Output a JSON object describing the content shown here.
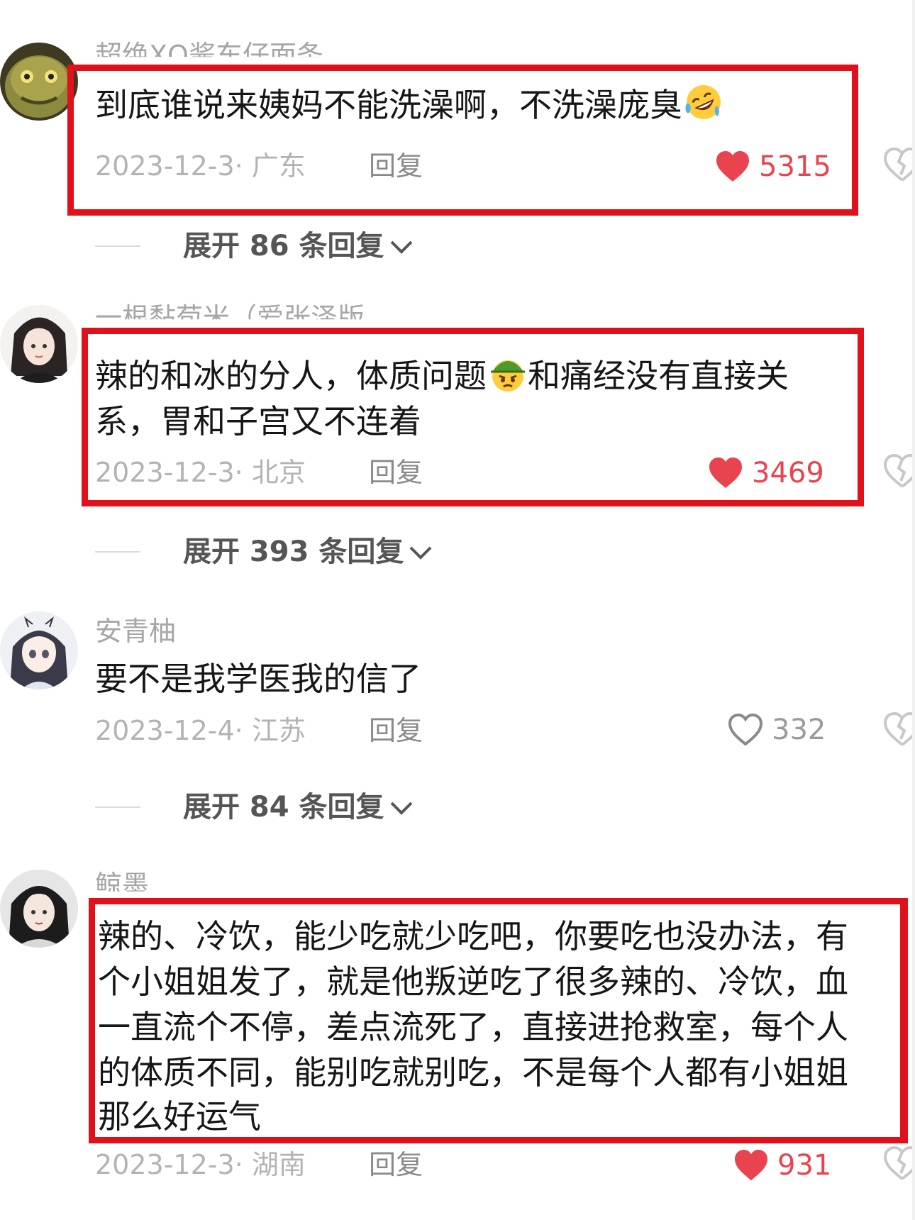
{
  "comments": [
    {
      "username": "超绝XQ酱东仔面条",
      "lines": [
        "到底谁说来姨妈不能洗澡啊，不洗澡庞臭"
      ],
      "emoji": "rofl-emoji",
      "date_location": "2023-12-3· 广东",
      "reply_label": "回复",
      "likes": "5315",
      "liked": true,
      "expand_label": "展开 86 条回复"
    },
    {
      "username": "一根黏苞米（爱张泽版",
      "lines": [
        "辣的和冰的分人，体质问题",
        "和痛经没有直接关",
        "系，胃和子宫又不连着"
      ],
      "emoji": "angry-helmet-emoji",
      "date_location": "2023-12-3· 北京",
      "reply_label": "回复",
      "likes": "3469",
      "liked": true,
      "expand_label": "展开 393 条回复"
    },
    {
      "username": "安青柚",
      "lines": [
        "要不是我学医我的信了"
      ],
      "date_location": "2023-12-4· 江苏",
      "reply_label": "回复",
      "likes": "332",
      "liked": false,
      "expand_label": "展开 84 条回复"
    },
    {
      "username": "鲸墨",
      "lines": [
        "辣的、冷饮，能少吃就少吃吧，你要吃也没办法，有",
        "个小姐姐发了，就是他叛逆吃了很多辣的、冷饮，血",
        "一直流个不停，差点流死了，直接进抢救室，每个人",
        "的体质不同，能别吃就别吃，不是每个人都有小姐姐",
        "那么好运气"
      ],
      "date_location": "2023-12-3· 湖南",
      "reply_label": "回复",
      "likes": "931",
      "liked": true
    }
  ],
  "colors": {
    "highlight_box": "#e1111c",
    "like_red": "#e8434f",
    "text": "#161616",
    "meta": "#b3b3b3"
  }
}
